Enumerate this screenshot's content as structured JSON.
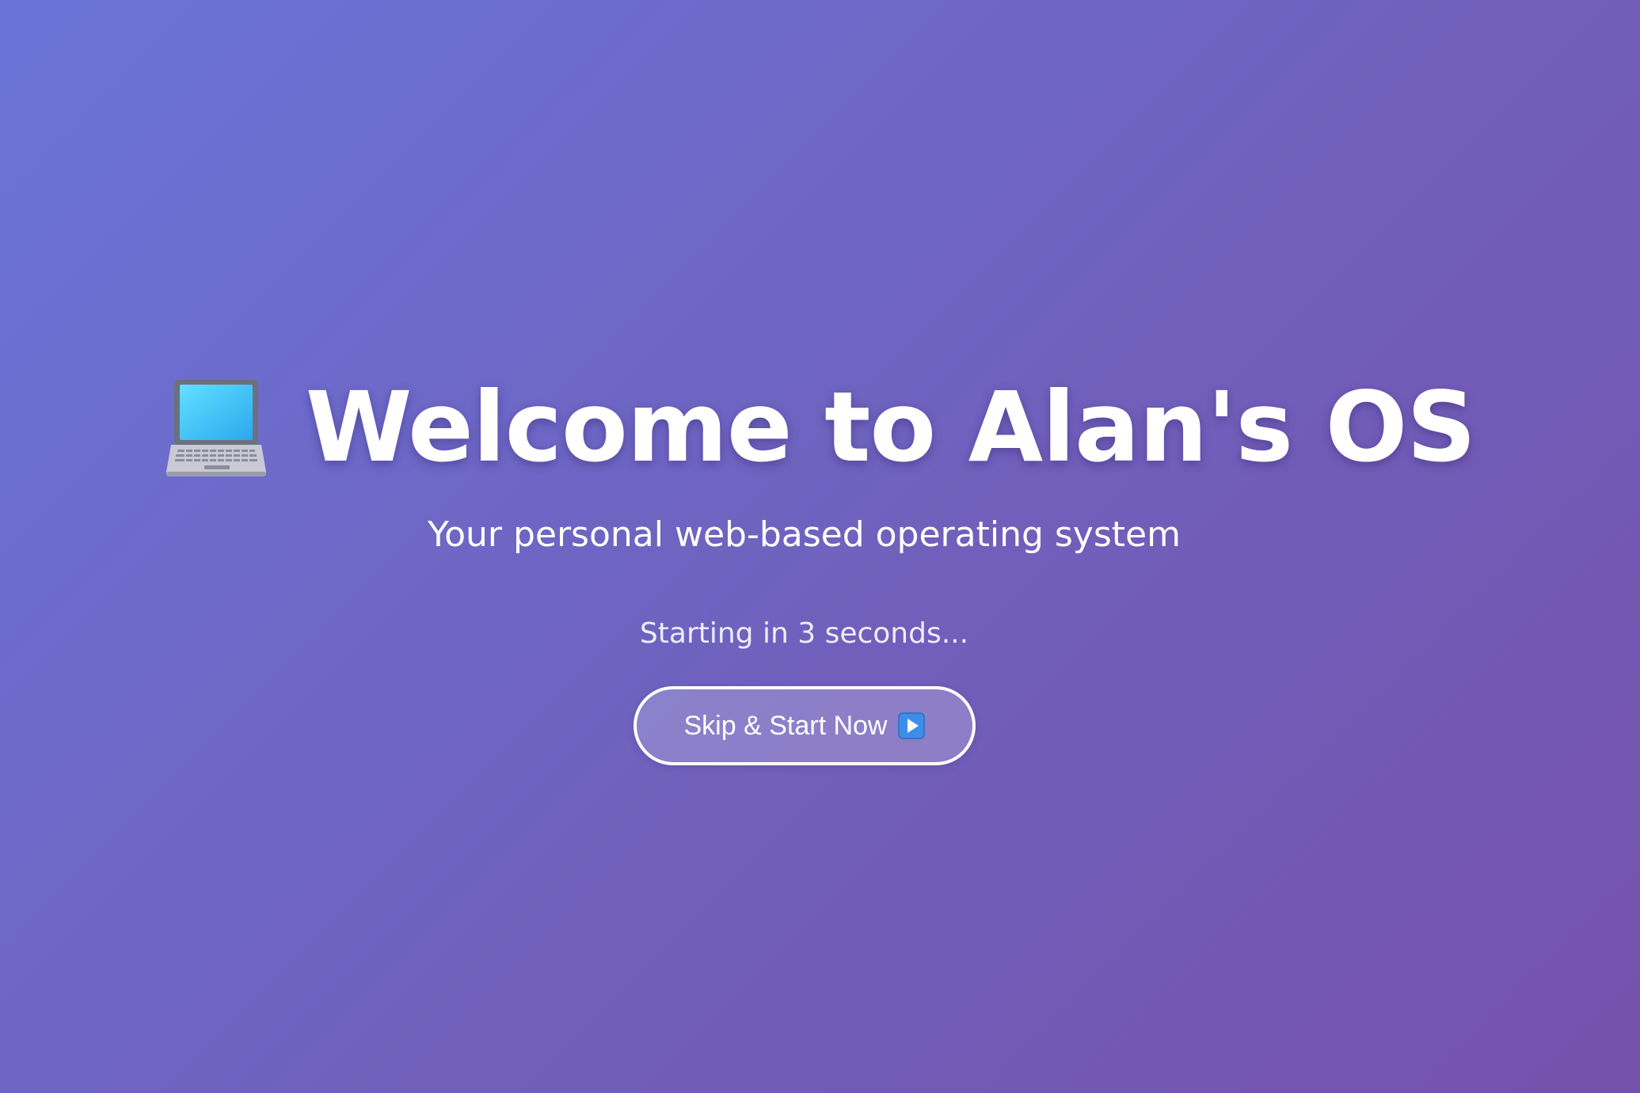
{
  "splash": {
    "icon": "laptop-icon",
    "title": "Welcome to Alan's OS",
    "subtitle": "Your personal web-based operating system",
    "countdown_text": "Starting in 3 seconds...",
    "skip_button": {
      "label": "Skip & Start Now",
      "icon": "play-icon"
    }
  },
  "colors": {
    "background_start": "#6a74d8",
    "background_end": "#7552ac",
    "text": "#ffffff",
    "play_icon": "#3d8ee8"
  }
}
